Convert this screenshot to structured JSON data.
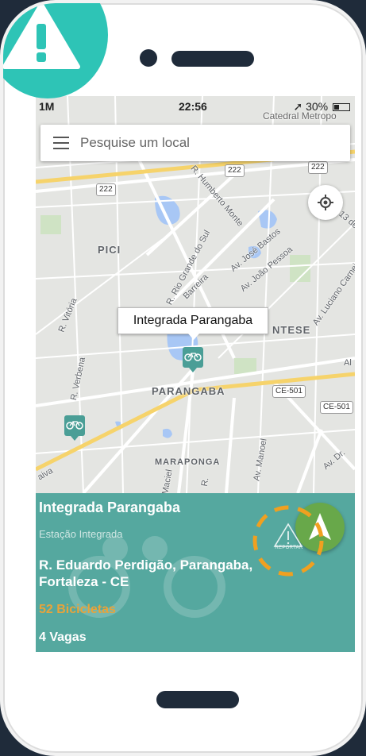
{
  "status_bar": {
    "left": "1M",
    "time": "22:56",
    "battery": "30%"
  },
  "search": {
    "placeholder": "Pesquise um local"
  },
  "map": {
    "area_labels": [
      "PICI",
      "PARANGABA",
      "MARAPONGA",
      "NTESE",
      "Catedral Metropo"
    ],
    "streets": [
      "R. Humberto Monte",
      "R. Rio Grande do Sul",
      "Av. José Bastos",
      "Av. João Pessoa",
      "Av. Luciano Carneiro",
      "R. Vitória",
      "R. Verbena",
      "R. Eduardo Perdigão",
      "13 de",
      "Av. Dr.",
      "Maciel",
      "Av. Manoel",
      "Barreira",
      "Al",
      "aiva",
      "R."
    ],
    "road_badges": [
      "222",
      "222",
      "222",
      "CE-501",
      "CE-501"
    ],
    "selected_station_tooltip": "Integrada Parangaba"
  },
  "station": {
    "name": "Integrada Parangaba",
    "type": "Estação Integrada",
    "address": "R. Eduardo Perdigão, Parangaba, Fortaleza - CE",
    "bikes": "52 Bicicletas",
    "spots": "4 Vagas",
    "report_label": "REPORTAR"
  },
  "colors": {
    "background": "#1f2b3a",
    "panel": "#55a89f",
    "bikes_text": "#e8a33a",
    "nav_button": "#68a84a",
    "alert_badge": "#2ec4b6",
    "report_ring": "#f0a020"
  },
  "icons": {
    "alert": "warning-triangle-icon",
    "menu": "hamburger-menu-icon",
    "locate": "gps-target-icon",
    "navigate": "navigation-arrow-icon",
    "bike": "bicycle-icon",
    "report": "warning-triangle-icon"
  }
}
